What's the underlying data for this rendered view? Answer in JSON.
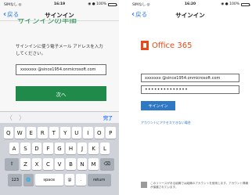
{
  "left_screen": {
    "status": {
      "carrier": "SIMなし ◎",
      "time": "16:19",
      "battery": "◉ ● 100%"
    },
    "nav": {
      "back_label": "戻る",
      "title": "サインイン"
    },
    "heading_partial": "サインインの手順",
    "instruction": "サインインに使う電子メール アドレスを入力してください。",
    "email_value": "xxxxxxx @since1954.onmicrosoft.com",
    "next_label": "次へ",
    "accessory": {
      "prev": "〈",
      "next": "〉",
      "done": "完了"
    },
    "keyboard": {
      "row1": [
        "Q",
        "W",
        "E",
        "R",
        "T",
        "Y",
        "U",
        "I",
        "O",
        "P"
      ],
      "row2": [
        "A",
        "S",
        "D",
        "F",
        "G",
        "H",
        "J",
        "K",
        "L"
      ],
      "row3": [
        "Z",
        "X",
        "C",
        "V",
        "B",
        "N",
        "M"
      ],
      "shift": "⇧",
      "delete": "⌫",
      "numbers": "123",
      "globe": "🌐",
      "space": "space",
      "at": "@",
      "period": ".",
      "return": "return"
    }
  },
  "right_screen": {
    "status": {
      "carrier": "SIMなし ◎",
      "time": "16:20",
      "battery": "◉ ● 100%"
    },
    "nav": {
      "back_label": "戻る",
      "title": "サインイン"
    },
    "brand_name": "Office 365",
    "brand_color": "#e64a19",
    "user_value": "xxxxxxx @since1954.onmicrosoft.com",
    "password_mask": "••••••••••••••",
    "signin_label": "サインイン",
    "cant_access": "アカウントにアクセスできない場合",
    "footer_text": "このリソースがある組織では組織のアカウントを使用します。アカウント情報が保護されています。"
  },
  "accent_green": "#1f8a4a",
  "link_blue": "#2f78c4"
}
